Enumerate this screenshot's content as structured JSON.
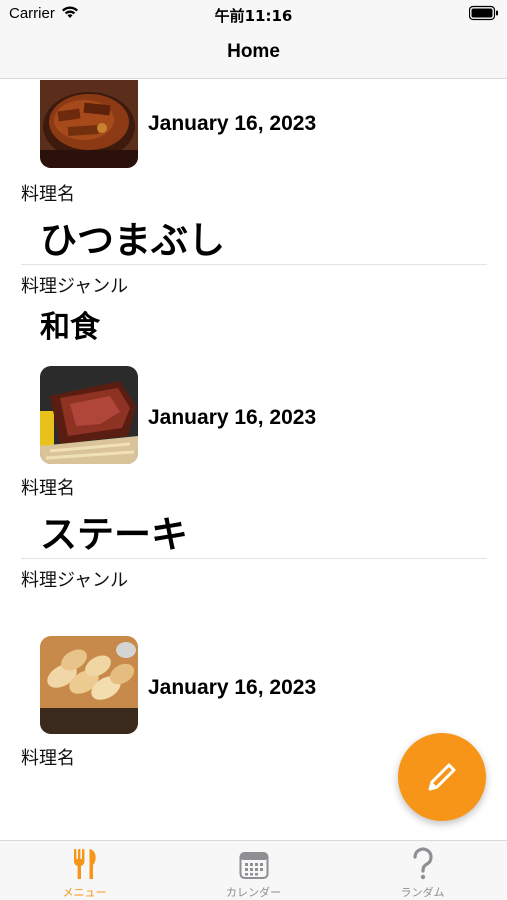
{
  "status_bar": {
    "carrier": "Carrier",
    "time": "午前11:16"
  },
  "nav": {
    "title": "Home"
  },
  "labels": {
    "dish_name": "料理名",
    "genre": "料理ジャンル"
  },
  "entries": [
    {
      "date": "January 16, 2023",
      "name": "ひつまぶし",
      "genre": "和食",
      "image": "unagi-rice-photo"
    },
    {
      "date": "January 16, 2023",
      "name": "ステーキ",
      "genre": "",
      "image": "steak-photo"
    },
    {
      "date": "January 16, 2023",
      "name": "",
      "genre": "",
      "image": "gyoza-photo"
    }
  ],
  "fab": {
    "icon": "pencil-icon"
  },
  "tabs": [
    {
      "label": "メニュー",
      "icon": "fork-knife-icon",
      "active": true
    },
    {
      "label": "カレンダー",
      "icon": "calendar-icon",
      "active": false
    },
    {
      "label": "ランダム",
      "icon": "question-mark-icon",
      "active": false
    }
  ],
  "colors": {
    "accent": "#f79518",
    "inactive": "#8e8e93",
    "bar_bg": "#f7f7f7"
  }
}
